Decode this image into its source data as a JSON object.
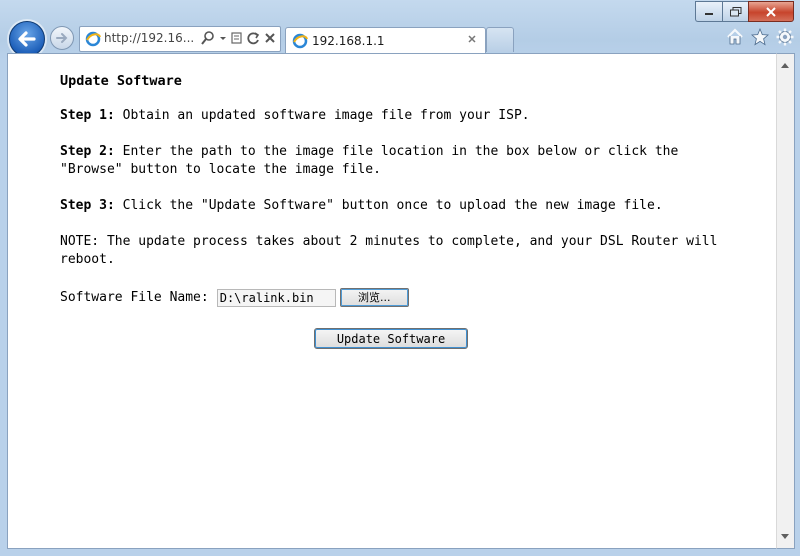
{
  "browser": {
    "address": "http://192.16...",
    "tab_title": "192.168.1.1",
    "icons": [
      "back-icon",
      "forward-icon",
      "ie-icon",
      "search-icon",
      "compat-icon",
      "refresh-icon",
      "stop-icon",
      "close-icon",
      "home-icon",
      "favorites-icon",
      "settings-icon"
    ]
  },
  "page": {
    "title": "Update Software",
    "step1_label": "Step 1:",
    "step1_text": " Obtain an updated software image file from your ISP.",
    "step2_label": "Step 2:",
    "step2_text": " Enter the path to the image file location in the box below or click the \"Browse\" button to locate the image file.",
    "step3_label": "Step 3:",
    "step3_text": " Click the \"Update Software\" button once to upload the new image file.",
    "note": "NOTE: The update process takes about 2 minutes to complete, and your DSL Router will reboot.",
    "file_label": "Software File Name:",
    "file_value": "D:\\ralink.bin",
    "browse_label": "浏览...",
    "update_label": "Update Software"
  }
}
